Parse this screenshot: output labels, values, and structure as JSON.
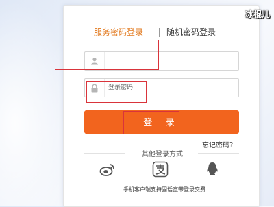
{
  "login": {
    "tabs": [
      "服务密码登录",
      "随机密码登录"
    ],
    "username": {
      "value": "",
      "placeholder": ""
    },
    "password": {
      "value": "",
      "placeholder": "登录密码"
    },
    "login_button": "登 录",
    "forgot_password": "忘记密码？",
    "other_login_title": "其他登录方式",
    "social_icons": [
      "weibo-icon",
      "alipay-icon",
      "qq-icon"
    ],
    "footer_note": "手机客户端支持固话宽带登录交费"
  },
  "watermark": "冰棍儿",
  "colors": {
    "accent": "#e2791e",
    "button": "#f2641e",
    "highlight_box": "#d9343b"
  }
}
